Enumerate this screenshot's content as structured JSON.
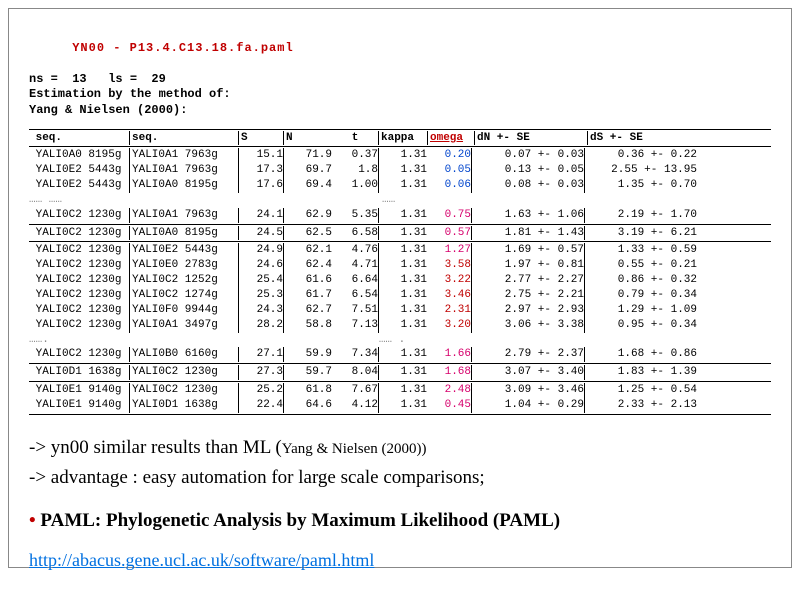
{
  "header": {
    "title_prefix": "YN00 - ",
    "title_file": "P13.4.C13.18.fa.paml",
    "ns_line": "ns =  13   ls =  29",
    "est_line": "Estimation by the method of:",
    "ref_line": "Yang & Nielsen (2000):"
  },
  "columns": {
    "seq1": "seq.",
    "seq2": "seq.",
    "S": "S",
    "N": "N",
    "t": "t",
    "kappa": "kappa",
    "omega": "omega",
    "dN": "dN +- SE",
    "dS": "dS +- SE"
  },
  "rows": [
    {
      "s1": "YALI0A0 8195g",
      "s2": "YALI0A1 7963g",
      "S": "15.1",
      "N": "71.9",
      "t": "0.37",
      "kappa": "1.31",
      "omega": "0.20",
      "omega_cls": "omega-blue",
      "dN": "0.07 +- 0.03",
      "dS": "0.36 +- 0.22"
    },
    {
      "s1": "YALI0E2 5443g",
      "s2": "YALI0A1 7963g",
      "S": "17.3",
      "N": "69.7",
      "t": "1.8",
      "kappa": "1.31",
      "omega": "0.05",
      "omega_cls": "omega-blue",
      "dN": "0.13 +- 0.05",
      "dS": "2.55 +- 13.95"
    },
    {
      "s1": "YALI0E2 5443g",
      "s2": "YALI0A0 8195g",
      "S": "17.6",
      "N": "69.4",
      "t": "1.00",
      "kappa": "1.31",
      "omega": "0.06",
      "omega_cls": "omega-blue",
      "dN": "0.08 +- 0.03",
      "dS": "1.35 +- 0.70"
    }
  ],
  "gap1": "…… ……",
  "gap1r": "……",
  "rows2": [
    {
      "s1": "YALI0C2 1230g",
      "s2": "YALI0A1 7963g",
      "S": "24.1",
      "N": "62.9",
      "t": "5.35",
      "kappa": "1.31",
      "omega": "0.75",
      "omega_cls": "omega-pink",
      "dN": "1.63 +- 1.06",
      "dS": "2.19 +- 1.70"
    },
    {
      "s1": "YALI0C2 1230g",
      "s2": "YALI0A0 8195g",
      "S": "24.5",
      "N": "62.5",
      "t": "6.58",
      "kappa": "1.31",
      "omega": "0.57",
      "omega_cls": "omega-pink",
      "dN": "1.81 +- 1.43",
      "dS": "3.19 +- 6.21"
    },
    {
      "s1": "YALI0C2 1230g",
      "s2": "YALI0E2 5443g",
      "S": "24.9",
      "N": "62.1",
      "t": "4.76",
      "kappa": "1.31",
      "omega": "1.27",
      "omega_cls": "omega-pink",
      "dN": "1.69 +- 0.57",
      "dS": "1.33 +- 0.59"
    },
    {
      "s1": "YALI0C2 1230g",
      "s2": "YALI0E0 2783g",
      "S": "24.6",
      "N": "62.4",
      "t": "4.71",
      "kappa": "1.31",
      "omega": "3.58",
      "omega_cls": "omega-red",
      "dN": "1.97 +- 0.81",
      "dS": "0.55 +- 0.21"
    },
    {
      "s1": "YALI0C2 1230g",
      "s2": "YALI0C2 1252g",
      "S": "25.4",
      "N": "61.6",
      "t": "6.64",
      "kappa": "1.31",
      "omega": "3.22",
      "omega_cls": "omega-red",
      "dN": "2.77 +- 2.27",
      "dS": "0.86 +- 0.32"
    },
    {
      "s1": "YALI0C2 1230g",
      "s2": "YALI0C2 1274g",
      "S": "25.3",
      "N": "61.7",
      "t": "6.54",
      "kappa": "1.31",
      "omega": "3.46",
      "omega_cls": "omega-red",
      "dN": "2.75 +- 2.21",
      "dS": "0.79 +- 0.34"
    },
    {
      "s1": "YALI0C2 1230g",
      "s2": "YALI0F0 9944g",
      "S": "24.3",
      "N": "62.7",
      "t": "7.51",
      "kappa": "1.31",
      "omega": "2.31",
      "omega_cls": "omega-red",
      "dN": "2.97 +- 2.93",
      "dS": "1.29 +- 1.09"
    },
    {
      "s1": "YALI0C2 1230g",
      "s2": "YALI0A1 3497g",
      "S": "28.2",
      "N": "58.8",
      "t": "7.13",
      "kappa": "1.31",
      "omega": "3.20",
      "omega_cls": "omega-red",
      "dN": "3.06 +- 3.38",
      "dS": "0.95 +- 0.34"
    }
  ],
  "gap2": "…….",
  "gap2r": "…… .",
  "rows3": [
    {
      "s1": "YALI0C2 1230g",
      "s2": "YALI0B0 6160g",
      "S": "27.1",
      "N": "59.9",
      "t": "7.34",
      "kappa": "1.31",
      "omega": "1.66",
      "omega_cls": "omega-pink",
      "dN": "2.79 +- 2.37",
      "dS": "1.68 +- 0.86"
    },
    {
      "s1": "YALI0D1 1638g",
      "s2": "YALI0C2 1230g",
      "S": "27.3",
      "N": "59.7",
      "t": "8.04",
      "kappa": "1.31",
      "omega": "1.68",
      "omega_cls": "omega-pink",
      "dN": "3.07 +- 3.40",
      "dS": "1.83 +- 1.39"
    },
    {
      "s1": "YALI0E1 9140g",
      "s2": "YALI0C2 1230g",
      "S": "25.2",
      "N": "61.8",
      "t": "7.67",
      "kappa": "1.31",
      "omega": "2.48",
      "omega_cls": "omega-pink",
      "dN": "3.09 +- 3.46",
      "dS": "1.25 +- 0.54"
    },
    {
      "s1": "YALI0E1 9140g",
      "s2": "YALI0D1 1638g",
      "S": "22.4",
      "N": "64.6",
      "t": "4.12",
      "kappa": "1.31",
      "omega": "0.45",
      "omega_cls": "omega-pink",
      "dN": "1.04 +- 0.29",
      "dS": "2.33 +- 2.13"
    }
  ],
  "notes": {
    "n1a": "-> yn00   similar results than ML (",
    "n1b": "Yang & Nielsen (2000))",
    "n2": "-> advantage : easy automation for large scale comparisons;",
    "bullet": "• ",
    "paml": "PAML: Phylogenetic Analysis by Maximum Likelihood (PAML)",
    "url": "http://abacus.gene.ucl.ac.uk/software/paml.html"
  },
  "chart_data": {
    "type": "table",
    "title": "YN00 pairwise dN/dS (Yang & Nielsen 2000) — P13.4.C13.18.fa.paml",
    "ns": 13,
    "ls": 29,
    "columns": [
      "seq1",
      "seq2",
      "S",
      "N",
      "t",
      "kappa",
      "omega",
      "dN",
      "dN_SE",
      "dS",
      "dS_SE"
    ],
    "data": [
      [
        "YALI0A0 8195g",
        "YALI0A1 7963g",
        15.1,
        71.9,
        0.37,
        1.31,
        0.2,
        0.07,
        0.03,
        0.36,
        0.22
      ],
      [
        "YALI0E2 5443g",
        "YALI0A1 7963g",
        17.3,
        69.7,
        1.8,
        1.31,
        0.05,
        0.13,
        0.05,
        2.55,
        13.95
      ],
      [
        "YALI0E2 5443g",
        "YALI0A0 8195g",
        17.6,
        69.4,
        1.0,
        1.31,
        0.06,
        0.08,
        0.03,
        1.35,
        0.7
      ],
      [
        "YALI0C2 1230g",
        "YALI0A1 7963g",
        24.1,
        62.9,
        5.35,
        1.31,
        0.75,
        1.63,
        1.06,
        2.19,
        1.7
      ],
      [
        "YALI0C2 1230g",
        "YALI0A0 8195g",
        24.5,
        62.5,
        6.58,
        1.31,
        0.57,
        1.81,
        1.43,
        3.19,
        6.21
      ],
      [
        "YALI0C2 1230g",
        "YALI0E2 5443g",
        24.9,
        62.1,
        4.76,
        1.31,
        1.27,
        1.69,
        0.57,
        1.33,
        0.59
      ],
      [
        "YALI0C2 1230g",
        "YALI0E0 2783g",
        24.6,
        62.4,
        4.71,
        1.31,
        3.58,
        1.97,
        0.81,
        0.55,
        0.21
      ],
      [
        "YALI0C2 1230g",
        "YALI0C2 1252g",
        25.4,
        61.6,
        6.64,
        1.31,
        3.22,
        2.77,
        2.27,
        0.86,
        0.32
      ],
      [
        "YALI0C2 1230g",
        "YALI0C2 1274g",
        25.3,
        61.7,
        6.54,
        1.31,
        3.46,
        2.75,
        2.21,
        0.79,
        0.34
      ],
      [
        "YALI0C2 1230g",
        "YALI0F0 9944g",
        24.3,
        62.7,
        7.51,
        1.31,
        2.31,
        2.97,
        2.93,
        1.29,
        1.09
      ],
      [
        "YALI0C2 1230g",
        "YALI0A1 3497g",
        28.2,
        58.8,
        7.13,
        1.31,
        3.2,
        3.06,
        3.38,
        0.95,
        0.34
      ],
      [
        "YALI0C2 1230g",
        "YALI0B0 6160g",
        27.1,
        59.9,
        7.34,
        1.31,
        1.66,
        2.79,
        2.37,
        1.68,
        0.86
      ],
      [
        "YALI0D1 1638g",
        "YALI0C2 1230g",
        27.3,
        59.7,
        8.04,
        1.31,
        1.68,
        3.07,
        3.4,
        1.83,
        1.39
      ],
      [
        "YALI0E1 9140g",
        "YALI0C2 1230g",
        25.2,
        61.8,
        7.67,
        1.31,
        2.48,
        3.09,
        3.46,
        1.25,
        0.54
      ],
      [
        "YALI0E1 9140g",
        "YALI0D1 1638g",
        22.4,
        64.6,
        4.12,
        1.31,
        0.45,
        1.04,
        0.29,
        2.33,
        2.13
      ]
    ]
  }
}
